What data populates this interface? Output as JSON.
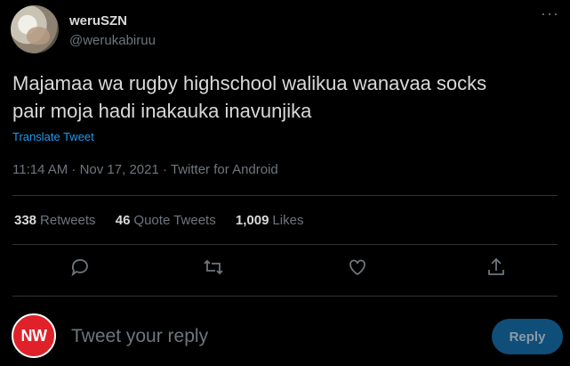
{
  "tweet": {
    "author_name": "weruSZN",
    "author_handle": "@werukabiruu",
    "text_line1": "Majamaa wa rugby highschool walikua wanavaa socks",
    "text_line2": "pair moja hadi inakauka inavunjika",
    "translate_label": "Translate Tweet",
    "meta": "11:14 AM · Nov 17, 2021 · Twitter for Android"
  },
  "stats": {
    "retweets_count": "338",
    "retweets_label": "Retweets",
    "quotes_count": "46",
    "quotes_label": "Quote Tweets",
    "likes_count": "1,009",
    "likes_label": "Likes"
  },
  "actions": {
    "reply_icon": "reply-icon",
    "retweet_icon": "retweet-icon",
    "like_icon": "heart-icon",
    "share_icon": "share-icon"
  },
  "compose": {
    "user_initials": "NW",
    "placeholder": "Tweet your reply",
    "reply_button": "Reply"
  },
  "colors": {
    "background": "#000000",
    "text": "#D9D9D9",
    "muted": "#6E767D",
    "link": "#1D9BF0",
    "reply_button_bg": "#0F4E78",
    "avatar_red": "#E0212A"
  }
}
